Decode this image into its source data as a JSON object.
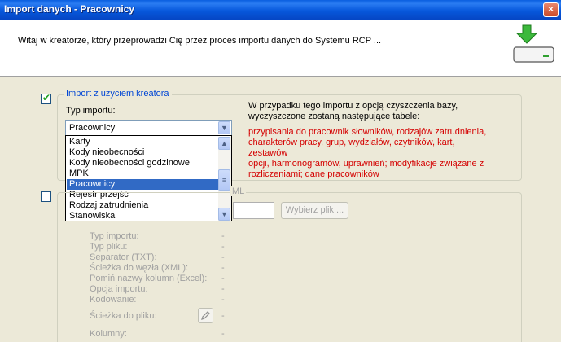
{
  "window": {
    "title": "Import danych - Pracownicy",
    "close_label": "×"
  },
  "header": {
    "welcome": "Witaj w kreatorze, który przeprowadzi Cię przez proces importu danych do Systemu RCP ..."
  },
  "wizard_group": {
    "legend": "Import z użyciem kreatora",
    "checked": true,
    "type_label": "Typ importu:",
    "selected_type": "Pracownicy",
    "options": [
      "Karty",
      "Kody nieobecności",
      "Kody nieobecności godzinowe",
      "MPK",
      "Pracownicy",
      "Rejestr przejść",
      "Rodzaj zatrudnienia",
      "Stanowiska"
    ],
    "info_line1": "W przypadku tego importu z opcją czyszczenia bazy,",
    "info_line2": "wyczyszczone zostaną następujące tabele:",
    "tables_line1": "przypisania do pracownik słowników, rodzajów zatrudnienia,",
    "tables_line2": "charakterów pracy, grup, wydziałów, czytników, kart, zestawów",
    "tables_line3": "opcji, harmonogramów, uprawnień; modyfikacje związane z",
    "tables_line4": "rozliczeniami; dane pracowników"
  },
  "file_group": {
    "legend_fragment": "ML",
    "checked": false,
    "choose_file_label": "Wybierz plik ...",
    "fields": [
      {
        "label": "Typ importu:",
        "value": "-"
      },
      {
        "label": "Typ pliku:",
        "value": "-"
      },
      {
        "label": "Separator (TXT):",
        "value": "-"
      },
      {
        "label": "Ścieżka do węzła (XML):",
        "value": "-"
      },
      {
        "label": "Pomiń nazwy kolumn (Excel):",
        "value": "-"
      },
      {
        "label": "Opcja importu:",
        "value": "-"
      },
      {
        "label": "Kodowanie:",
        "value": "-"
      },
      {
        "label": "Ścieżka do pliku:",
        "value": "-"
      },
      {
        "label": "Kolumny:",
        "value": "-"
      }
    ]
  }
}
